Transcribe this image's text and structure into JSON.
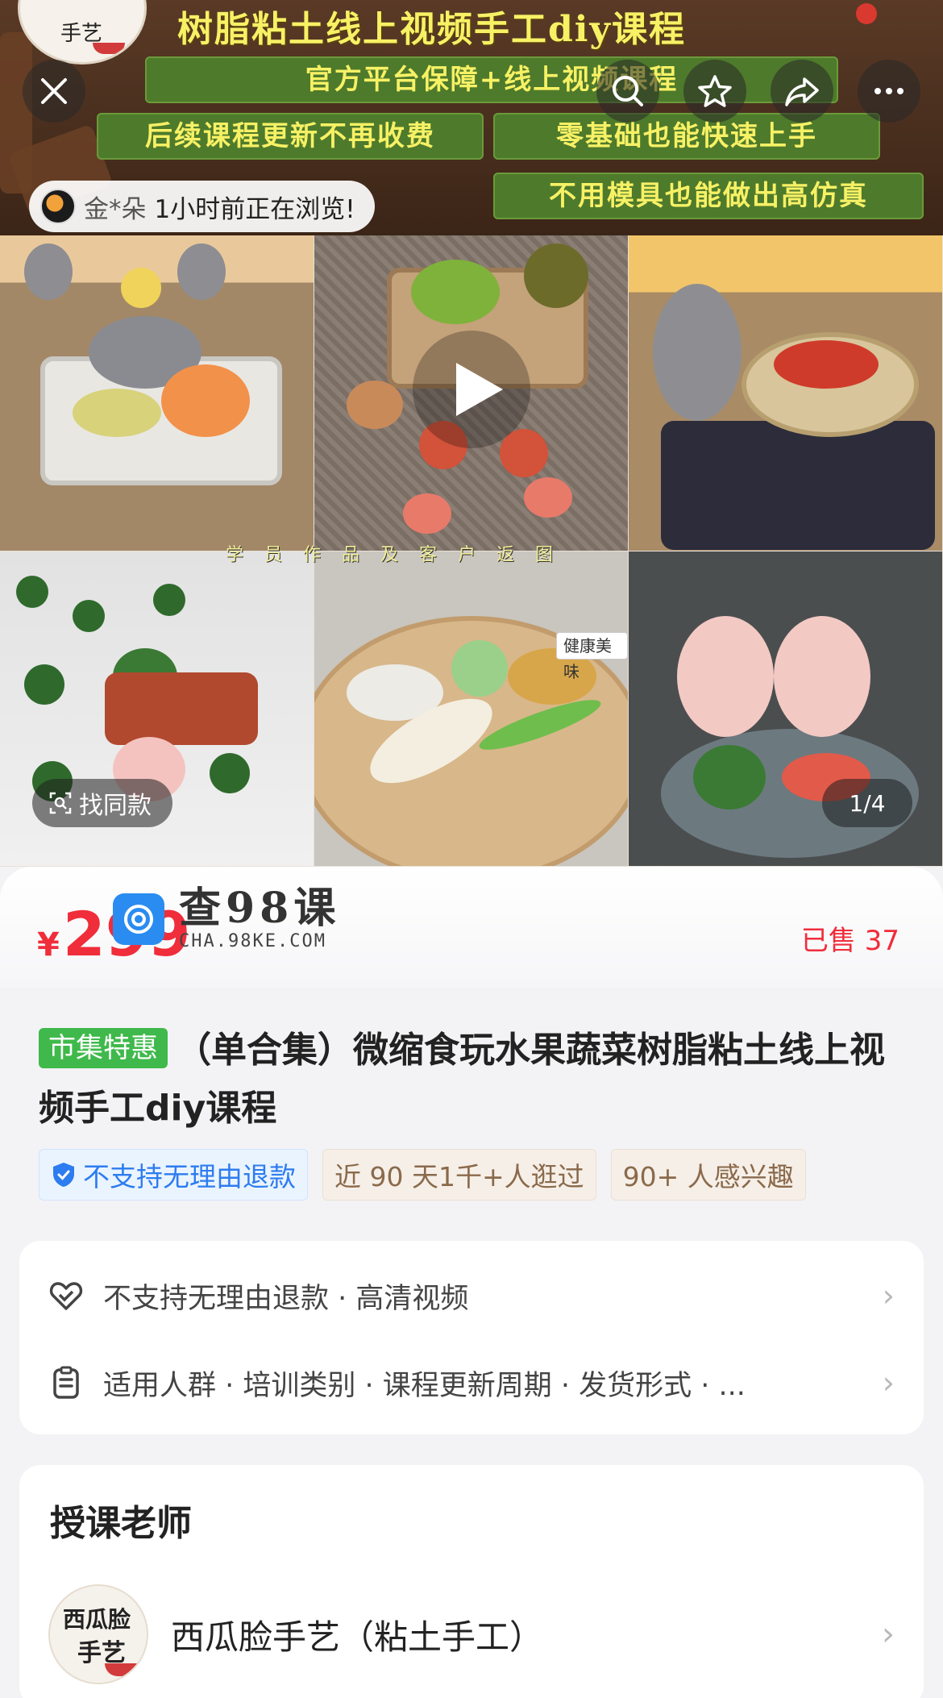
{
  "banner": {
    "title": "树脂粘土线上视频手工diy课程",
    "pills": [
      "官方平台保障+线上视频课程",
      "后续课程更新不再收费",
      "零基础也能快速上手",
      "不用模具也能做出高仿真"
    ],
    "logo_text": "手艺"
  },
  "top_actions": {
    "close": "close-icon",
    "search": "search-icon",
    "favorite": "star-icon",
    "share": "share-icon",
    "more": "more-icon"
  },
  "browsing": {
    "name": "金*朵",
    "text": "1小时前正在浏览!"
  },
  "gallery": {
    "caption": "学员作品及客户返图",
    "sticker": "健康美味",
    "find_same": "找同款",
    "page_indicator": "1/4"
  },
  "product": {
    "currency": "¥",
    "price": "299",
    "sold": "已售 37",
    "tag": "市集特惠",
    "title": "（单合集）微缩食玩水果蔬菜树脂粘土线上视频手工diy课程",
    "chips": [
      {
        "label": "不支持无理由退款",
        "style": "blue"
      },
      {
        "label": "近 90 天1千+人逛过",
        "style": "brown"
      },
      {
        "label": "90+ 人感兴趣",
        "style": "brown"
      }
    ]
  },
  "watermark": {
    "cn": "查98课",
    "en": "CHA.98KE.COM"
  },
  "info_rows": [
    {
      "icon": "heart-shield-icon",
      "text": "不支持无理由退款 · 高清视频"
    },
    {
      "icon": "clipboard-icon",
      "text": "适用人群 · 培训类别 · 课程更新周期 · 发货形式 · ..."
    }
  ],
  "teacher_section": {
    "title": "授课老师",
    "name": "西瓜脸手艺（粘土手工）",
    "avatar_line1": "西瓜脸",
    "avatar_line2": "手艺"
  },
  "colors": {
    "price_red": "#f02d3a",
    "tag_green": "#3fb94b",
    "chip_blue": "#2d7cf0",
    "banner_yellow": "#f7f165"
  }
}
